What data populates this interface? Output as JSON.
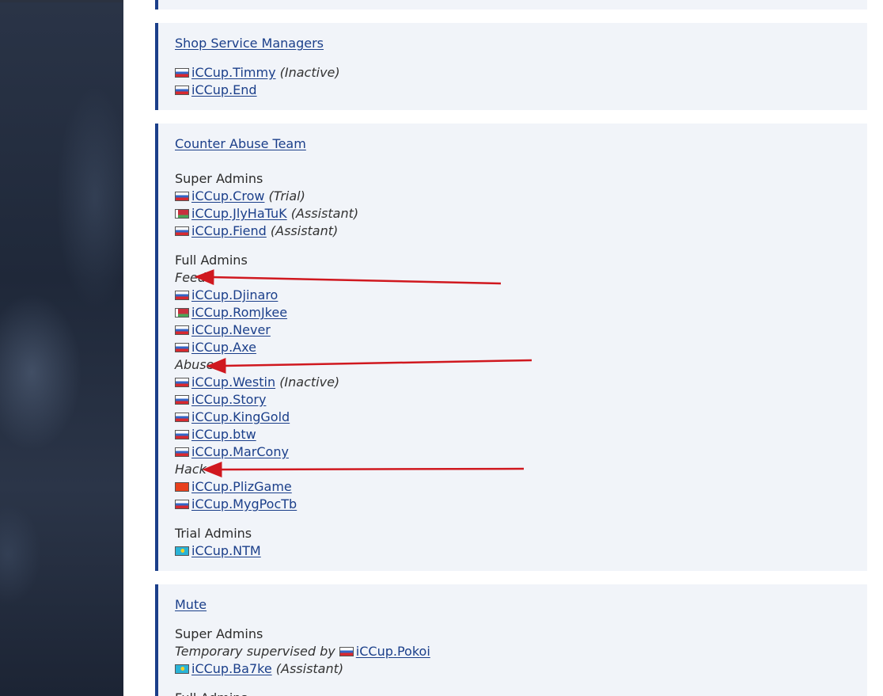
{
  "sections": {
    "shop": {
      "title": "Shop Service Managers",
      "members": [
        {
          "name": "iCCup.Timmy",
          "note": "(Inactive)",
          "flag": "ru"
        },
        {
          "name": "iCCup.End",
          "note": "",
          "flag": "ru"
        }
      ]
    },
    "cat": {
      "title": "Counter Abuse Team",
      "super_admins_label": "Super Admins",
      "super_admins": [
        {
          "name": "iCCup.Crow",
          "note": "(Trial)",
          "flag": "ru"
        },
        {
          "name": "iCCup.JlyHaTuK",
          "note": "(Assistant)",
          "flag": "by"
        },
        {
          "name": "iCCup.Fiend",
          "note": "(Assistant)",
          "flag": "ru"
        }
      ],
      "full_admins_label": "Full Admins",
      "feed_label": "Feed",
      "feed": [
        {
          "name": "iCCup.Djinaro",
          "flag": "ru"
        },
        {
          "name": "iCCup.RomJkee",
          "flag": "by"
        },
        {
          "name": "iCCup.Never",
          "flag": "ru"
        },
        {
          "name": "iCCup.Axe",
          "flag": "ru"
        }
      ],
      "abuse_label": "Abuse",
      "abuse": [
        {
          "name": "iCCup.Westin",
          "note": "(Inactive)",
          "flag": "ru"
        },
        {
          "name": "iCCup.Story",
          "flag": "ru"
        },
        {
          "name": "iCCup.KingGold",
          "flag": "ru"
        },
        {
          "name": "iCCup.btw",
          "flag": "ru"
        },
        {
          "name": "iCCup.MarCony",
          "flag": "ru"
        }
      ],
      "hack_label": "Hack",
      "hack": [
        {
          "name": "iCCup.PlizGame",
          "flag": "kg"
        },
        {
          "name": "iCCup.MygPocTb",
          "flag": "ru"
        }
      ],
      "trial_admins_label": "Trial Admins",
      "trial_admins": [
        {
          "name": "iCCup.NTM",
          "flag": "kz"
        }
      ]
    },
    "mute": {
      "title": "Mute",
      "super_admins_label": "Super Admins",
      "temp_text": "Temporary supervised by",
      "temp_name": "iCCup.Pokoi",
      "members": [
        {
          "name": "iCCup.Ba7ke",
          "note": "(Assistant)",
          "flag": "kz"
        }
      ],
      "full_admins_label": "Full Admins"
    }
  },
  "colors": {
    "link": "#1b3f8a",
    "card_bg": "#f1f4f9",
    "card_border": "#1b3f8a",
    "arrow": "#d0181f"
  }
}
